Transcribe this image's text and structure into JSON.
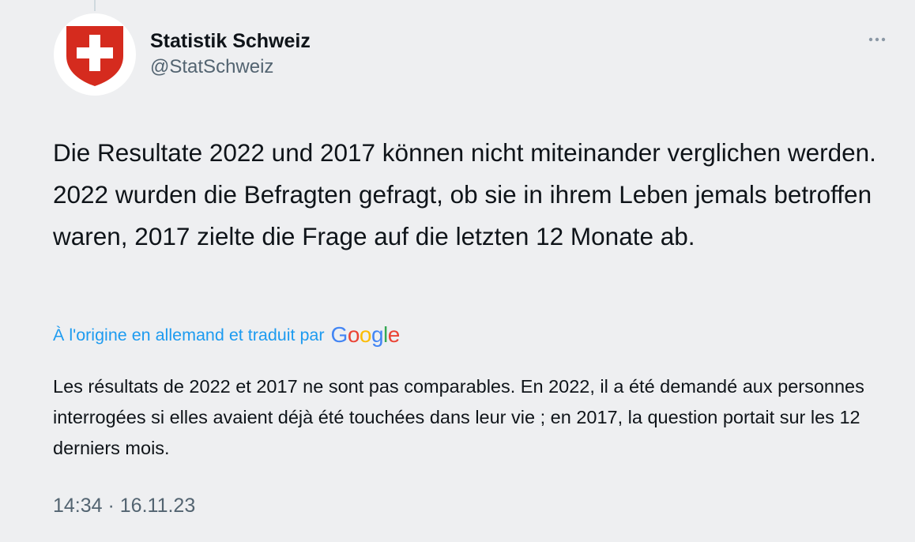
{
  "author": {
    "display_name": "Statistik Schweiz",
    "handle": "@StatSchweiz"
  },
  "tweet": {
    "text": "Die Resultate 2022 und 2017 können nicht miteinander verglichen werden. 2022 wurden die Befragten gefragt, ob sie in ihrem Leben jemals betroffen waren, 2017 zielte die Frage auf die letzten 12 Monate ab.",
    "translation_note": "À l'origine en allemand et traduit par",
    "translation_provider": "Google",
    "translated_text": "Les résultats de 2022 et 2017 ne sont pas comparables. En 2022, il a été demandé aux personnes interrogées si elles avaient déjà été touchées dans leur vie ; en 2017, la question portait sur les 12 derniers mois.",
    "timestamp": "14:34 · 16.11.23"
  },
  "icons": {
    "avatar": "swiss-coat-of-arms-icon",
    "more": "more-horizontal-icon"
  },
  "colors": {
    "background": "#eeeff1",
    "text_primary": "#0f1419",
    "text_secondary": "#536471",
    "link": "#1d9bf0",
    "swiss_red": "#d52b1e"
  }
}
